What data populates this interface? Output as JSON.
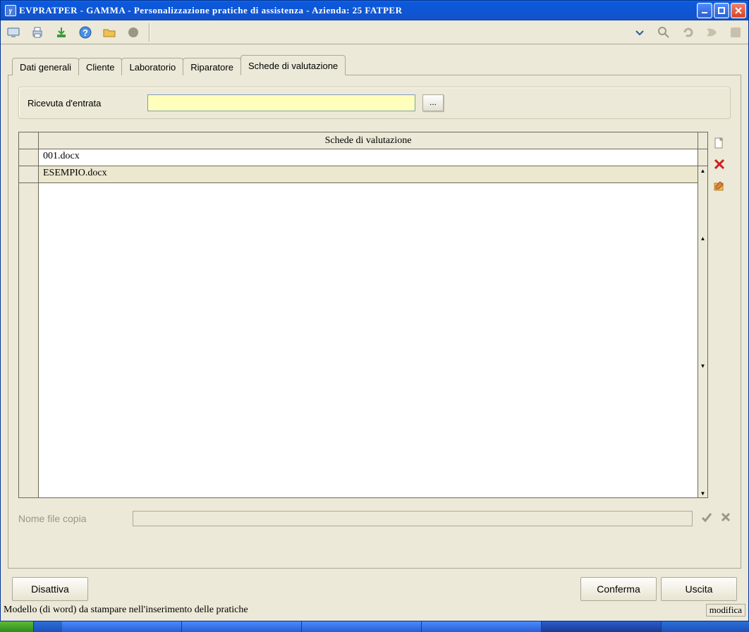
{
  "title": "EVPRATPER - GAMMA - Personalizzazione pratiche di assistenza - Azienda:   25 FATPER",
  "titlebar_glyph": "γ",
  "tabs": {
    "t0": "Dati generali",
    "t1": "Cliente",
    "t2": "Laboratorio",
    "t3": "Riparatore",
    "t4": "Schede di valutazione"
  },
  "ricevuta": {
    "label": "Ricevuta d'entrata",
    "value": "",
    "browse": "..."
  },
  "grid": {
    "header": "Schede di valutazione",
    "rows": [
      "001.docx",
      "ESEMPIO.docx"
    ]
  },
  "copy": {
    "label": "Nome file copia",
    "value": ""
  },
  "buttons": {
    "disattiva": "Disattiva",
    "conferma": "Conferma",
    "uscita": "Uscita"
  },
  "status": {
    "text": "Modello (di word) da stampare nell'inserimento delle pratiche",
    "mode": "modifica"
  },
  "scroll_glyphs": {
    "up": "▲",
    "down": "▼"
  }
}
